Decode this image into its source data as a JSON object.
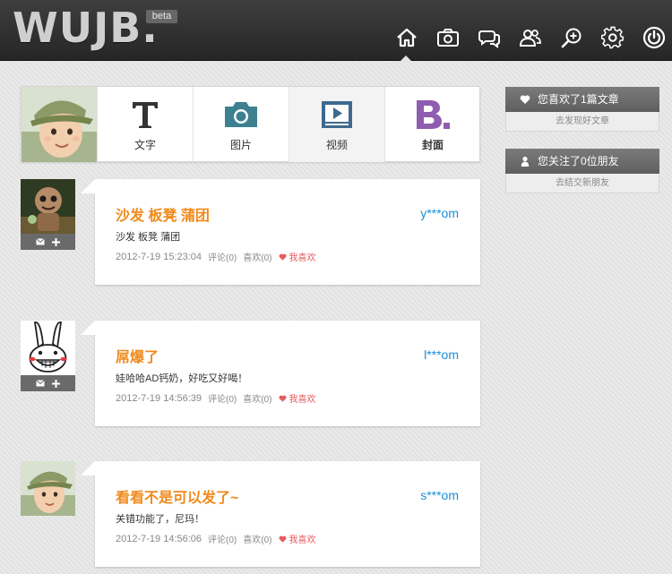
{
  "header": {
    "logo": "WUJB.",
    "beta": "beta",
    "nav_icons": [
      "home-icon",
      "camera-icon",
      "chat-icon",
      "friends-icon",
      "search-add-icon",
      "settings-gear-icon",
      "power-icon"
    ]
  },
  "composer": {
    "types": [
      {
        "icon": "text-T-icon",
        "label": "文字"
      },
      {
        "icon": "camera-icon",
        "label": "图片"
      },
      {
        "icon": "video-icon",
        "label": "视频"
      },
      {
        "icon": "cover-B-icon",
        "label": "封面"
      }
    ]
  },
  "sidebar": {
    "likes": {
      "title": "您喜欢了1篇文章",
      "link": "去发现好文章",
      "icon": "heart-icon"
    },
    "follows": {
      "title": "您关注了0位朋友",
      "link": "去结交新朋友",
      "icon": "user-icon"
    }
  },
  "posts": [
    {
      "title": "沙发 板凳 蒲团",
      "user": "y***om",
      "body": "沙发 板凳 蒲团",
      "time": "2012-7-19 15:23:04",
      "comments": "评论(0)",
      "likes": "喜欢(0)",
      "like_action": "我喜欢"
    },
    {
      "title": "屌爆了",
      "user": "l***om",
      "body": "娃哈哈AD钙奶，好吃又好喝！",
      "time": "2012-7-19 14:56:39",
      "comments": "评论(0)",
      "likes": "喜欢(0)",
      "like_action": "我喜欢"
    },
    {
      "title": "看看不是可以发了~",
      "user": "s***om",
      "body": "关错功能了，尼玛！",
      "time": "2012-7-19 14:56:06",
      "comments": "评论(0)",
      "likes": "喜欢(0)",
      "like_action": "我喜欢"
    }
  ],
  "colors": {
    "accent_orange": "#f08a1c",
    "user_blue": "#1a8fd8",
    "like_red": "#e65a5a",
    "topbar": "#2d2d2d"
  }
}
